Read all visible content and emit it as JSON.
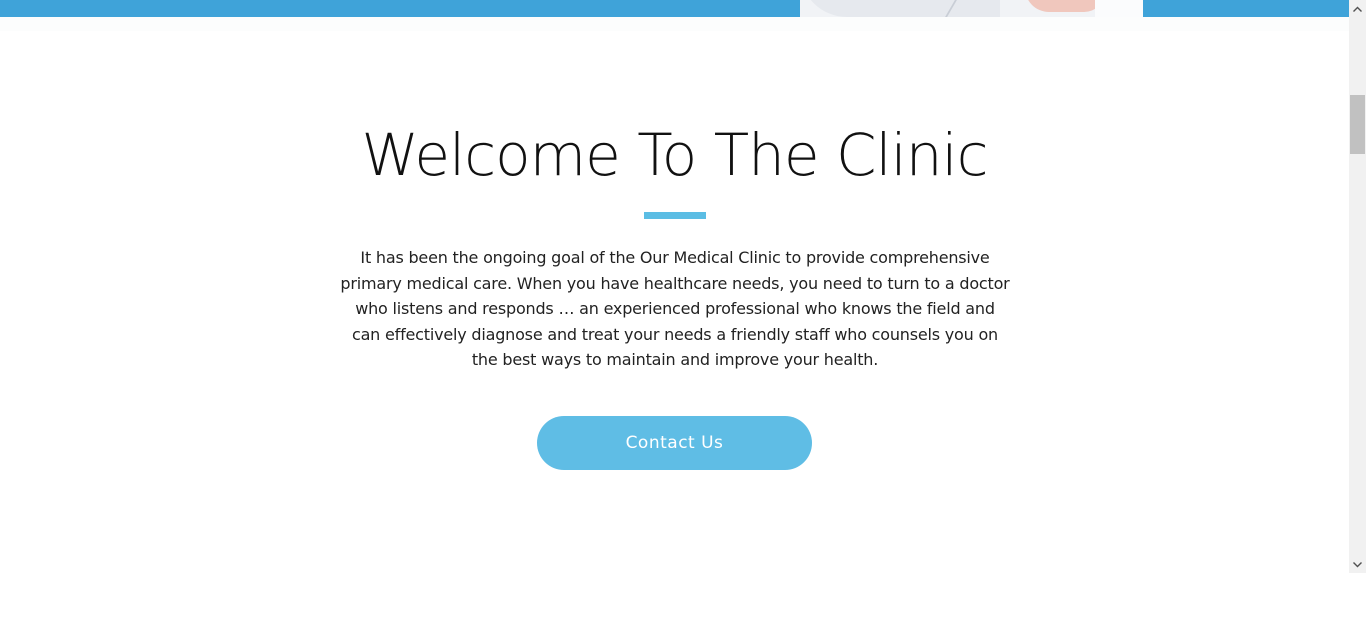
{
  "welcome": {
    "title": "Welcome To The Clinic",
    "body": "It has been the ongoing goal of the Our Medical Clinic to provide comprehensive primary medical care. When you have healthcare needs, you need to turn to a doctor who listens and responds … an experienced professional who knows the field and can effectively diagnose and treat your needs a friendly staff who counsels you on the best ways to maintain and improve your health.",
    "cta_label": "Contact Us"
  },
  "scrollbar": {
    "up_icon": "chevron-up-icon",
    "down_icon": "chevron-down-icon"
  },
  "colors": {
    "hero_band": "#3fa3d9",
    "accent": "#5bbde4",
    "button": "#5fbde5",
    "title_text": "#111111",
    "body_text": "#222222"
  }
}
